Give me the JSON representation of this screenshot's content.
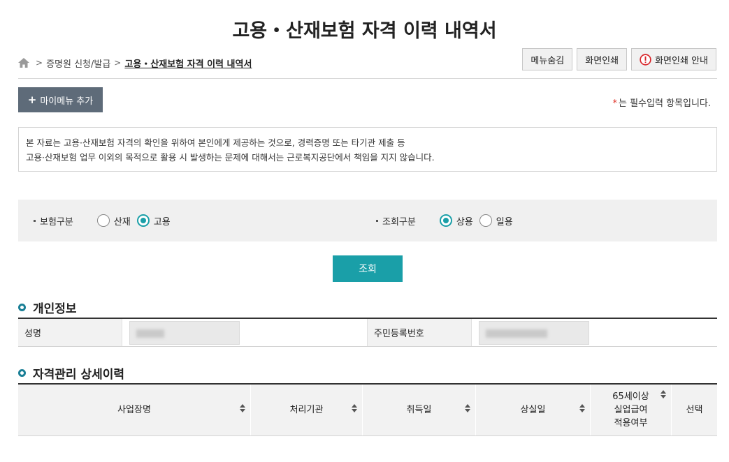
{
  "page": {
    "title": "고용・산재보험 자격 이력 내역서"
  },
  "breadcrumb": {
    "items": [
      "증명원 신청/발급",
      "고용・산재보험 자격 이력 내역서"
    ],
    "separator": ">"
  },
  "toolbar": {
    "hide_menu": "메뉴숨김",
    "print_screen": "화면인쇄",
    "print_guide": "화면인쇄 안내"
  },
  "mymenu": {
    "plus": "+",
    "label": "마이메뉴 추가"
  },
  "required_note": {
    "star": "*",
    "text": "는 필수입력 항목입니다."
  },
  "notice": {
    "line1": "본 자료는 고용·산재보험 자격의 확인을 위하여 본인에게 제공하는 것으로, 경력증명 또는 타기관 제출 등",
    "line2": "고용·산재보험 업무 이외의 목적으로 활용 시 발생하는 문제에 대해서는 근로복지공단에서 책임을 지지 않습니다."
  },
  "search": {
    "insurance_type": {
      "label": "보험구분",
      "options": [
        {
          "label": "산재",
          "checked": false
        },
        {
          "label": "고용",
          "checked": true
        }
      ]
    },
    "query_type": {
      "label": "조회구분",
      "options": [
        {
          "label": "상용",
          "checked": true
        },
        {
          "label": "일용",
          "checked": false
        }
      ]
    },
    "button": "조회"
  },
  "personal_info": {
    "title": "개인정보",
    "name_label": "성명",
    "rrn_label": "주민등록번호"
  },
  "history": {
    "title": "자격관리 상세이력",
    "columns": [
      {
        "label": "사업장명",
        "sortable": true
      },
      {
        "label": "처리기관",
        "sortable": true
      },
      {
        "label": "취득일",
        "sortable": true
      },
      {
        "label": "상실일",
        "sortable": true
      },
      {
        "label_lines": [
          "65세이상",
          "실업급여",
          "적용여부"
        ],
        "sortable": true
      },
      {
        "label": "선택",
        "sortable": false
      }
    ]
  },
  "colors": {
    "accent": "#1a9fa8",
    "mymenu_bg": "#5e6b79",
    "required": "#e0352b",
    "alert": "#d9262b"
  },
  "icons": [
    "home-icon",
    "alert-icon",
    "sort-icon",
    "section-ring-icon"
  ]
}
